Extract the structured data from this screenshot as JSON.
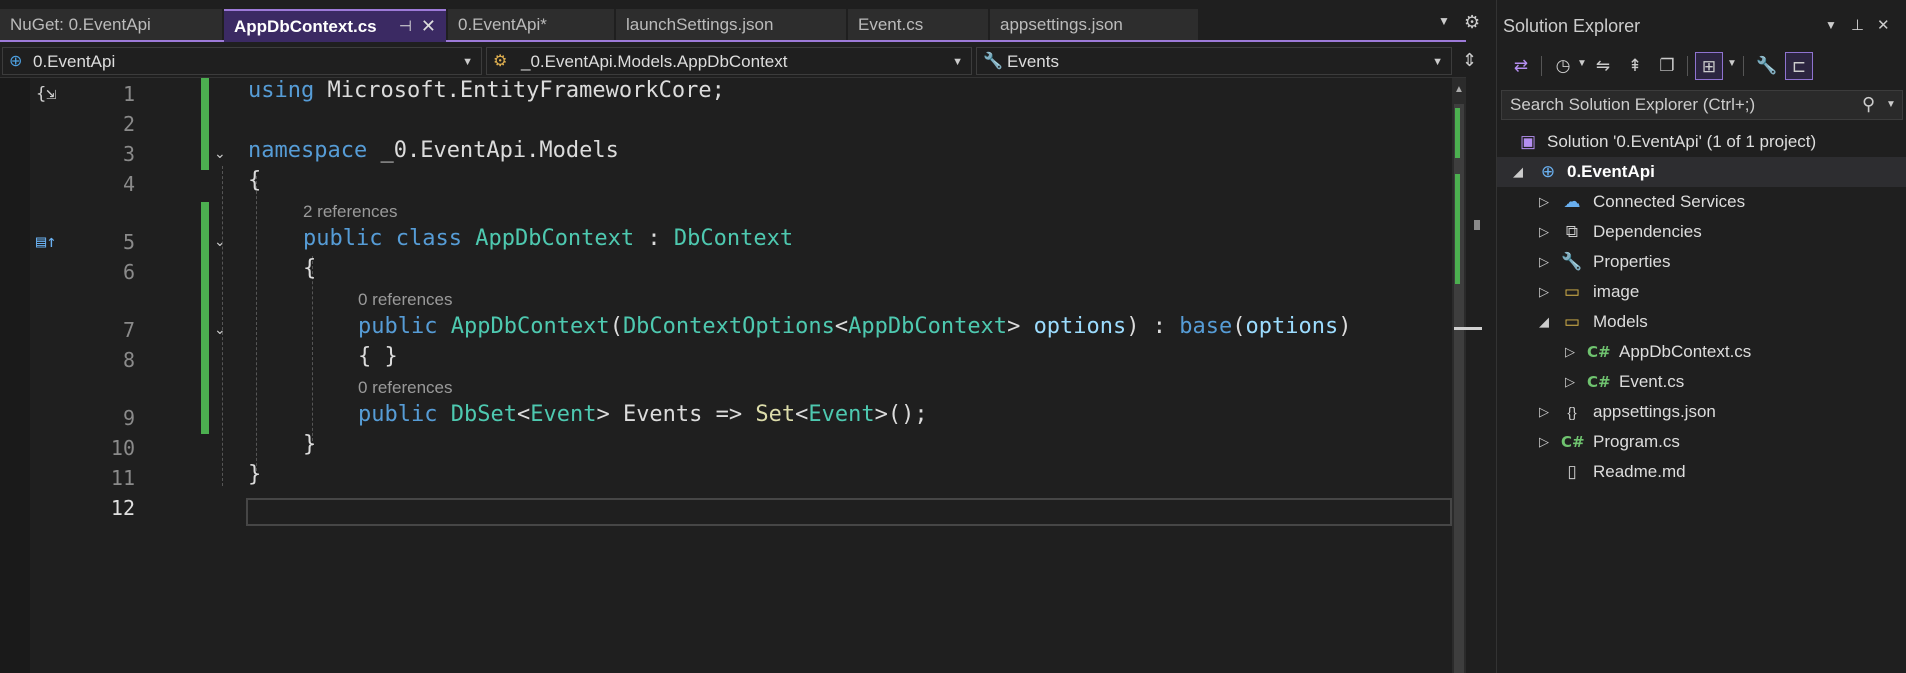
{
  "tabs": [
    {
      "label": "NuGet: 0.EventApi",
      "active": false
    },
    {
      "label": "AppDbContext.cs",
      "active": true
    },
    {
      "label": "0.EventApi*",
      "active": false
    },
    {
      "label": "launchSettings.json",
      "active": false
    },
    {
      "label": "Event.cs",
      "active": false
    },
    {
      "label": "appsettings.json",
      "active": false
    }
  ],
  "tab_icons": {
    "pin": "⊣",
    "close": "✕",
    "overflow": "▼",
    "settings": "⚙"
  },
  "nav": {
    "project": "0.EventApi",
    "type": "_0.EventApi.Models.AppDbContext",
    "member": "Events"
  },
  "editor": {
    "line_numbers": [
      "1",
      "2",
      "3",
      "4",
      "5",
      "6",
      "7",
      "8",
      "9",
      "10",
      "11",
      "12"
    ],
    "lens": {
      "class_refs": "2 references",
      "ctor_refs": "0 references",
      "prop_refs": "0 references"
    },
    "code": {
      "l1": {
        "kw": "using",
        "rest": " Microsoft.EntityFrameworkCore;"
      },
      "l3": {
        "kw": "namespace",
        "rest": " _0.EventApi.Models"
      },
      "l4": "{",
      "l5": {
        "kw1": "public",
        "kw2": "class",
        "name": "AppDbContext",
        "sep": " : ",
        "base": "DbContext"
      },
      "l6": "{",
      "l7": {
        "kw": "public",
        "ctor": "AppDbContext",
        "p1": "(",
        "t1": "DbContextOptions",
        "lt": "<",
        "t2": "AppDbContext",
        "gt": ">",
        "param": "options",
        "p2": ") : ",
        "base_kw": "base",
        "p3": "(",
        "arg": "options",
        "p4": ")"
      },
      "l8": "{ }",
      "l9": {
        "kw": "public",
        "t1": "DbSet",
        "lt": "<",
        "t2": "Event",
        "gt": "> Events => ",
        "mt": "Set",
        "lt2": "<",
        "t3": "Event",
        "end": ">();"
      },
      "l10": "}",
      "l11": "}"
    }
  },
  "solution_explorer": {
    "title": "Solution Explorer",
    "search_placeholder": "Search Solution Explorer (Ctrl+;)",
    "tree": [
      {
        "label": "Solution '0.EventApi' (1 of 1 project)",
        "icon": "solution-icon"
      },
      {
        "label": "0.EventApi",
        "icon": "web-project-icon"
      },
      {
        "label": "Connected Services",
        "icon": "connected-services-icon"
      },
      {
        "label": "Dependencies",
        "icon": "dependencies-icon"
      },
      {
        "label": "Properties",
        "icon": "properties-folder-icon"
      },
      {
        "label": "image",
        "icon": "folder-icon"
      },
      {
        "label": "Models",
        "icon": "folder-icon"
      },
      {
        "label": "AppDbContext.cs",
        "icon": "csharp-file-icon"
      },
      {
        "label": "Event.cs",
        "icon": "csharp-file-icon"
      },
      {
        "label": "appsettings.json",
        "icon": "json-file-icon"
      },
      {
        "label": "Program.cs",
        "icon": "csharp-file-icon"
      },
      {
        "label": "Readme.md",
        "icon": "markdown-file-icon"
      }
    ],
    "cs_glyph": "C#"
  },
  "colors": {
    "accent": "#9d7ad8",
    "change_bar": "#4caf50",
    "keyword": "#569cd6",
    "type": "#4ec9b0",
    "param": "#9cdcfe",
    "method": "#dcdcaa"
  }
}
